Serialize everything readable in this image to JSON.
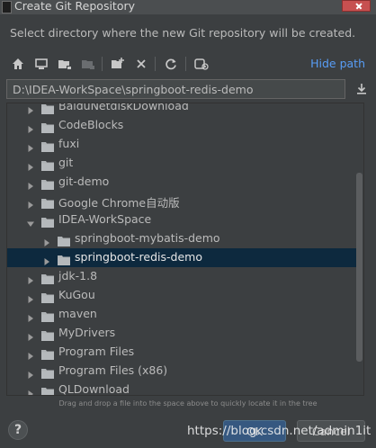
{
  "window": {
    "title": "Create Git Repository"
  },
  "dialog": {
    "description": "Select directory where the new Git repository will be created."
  },
  "toolbar": {
    "buttons": [
      {
        "icon": "home-icon",
        "tooltip": "Home Directory"
      },
      {
        "icon": "desktop-icon",
        "tooltip": "Desktop Directory"
      },
      {
        "icon": "project-folder-icon",
        "tooltip": "Project Directory"
      },
      {
        "icon": "module-folder-icon",
        "tooltip": "Module Directory"
      },
      {
        "icon": "new-folder-icon",
        "tooltip": "New Folder"
      },
      {
        "icon": "delete-icon",
        "tooltip": "Delete"
      },
      {
        "icon": "refresh-icon",
        "tooltip": "Refresh"
      },
      {
        "icon": "show-hidden-icon",
        "tooltip": "Show Hidden Files"
      }
    ],
    "hide_path_label": "Hide path"
  },
  "path": {
    "value": "D:\\IDEA-WorkSpace\\springboot-redis-demo"
  },
  "tree": {
    "items": [
      {
        "label": "BaiduNetdiskDownload",
        "expanded": false,
        "level": 0,
        "selected": false
      },
      {
        "label": "CodeBlocks",
        "expanded": false,
        "level": 0,
        "selected": false
      },
      {
        "label": "fuxi",
        "expanded": false,
        "level": 0,
        "selected": false
      },
      {
        "label": "git",
        "expanded": false,
        "level": 0,
        "selected": false
      },
      {
        "label": "git-demo",
        "expanded": false,
        "level": 0,
        "selected": false
      },
      {
        "label": "Google Chrome自动版",
        "expanded": false,
        "level": 0,
        "selected": false
      },
      {
        "label": "IDEA-WorkSpace",
        "expanded": true,
        "level": 0,
        "selected": false
      },
      {
        "label": "springboot-mybatis-demo",
        "expanded": false,
        "level": 1,
        "selected": false
      },
      {
        "label": "springboot-redis-demo",
        "expanded": false,
        "level": 1,
        "selected": true
      },
      {
        "label": "jdk-1.8",
        "expanded": false,
        "level": 0,
        "selected": false
      },
      {
        "label": "KuGou",
        "expanded": false,
        "level": 0,
        "selected": false
      },
      {
        "label": "maven",
        "expanded": false,
        "level": 0,
        "selected": false
      },
      {
        "label": "MyDrivers",
        "expanded": false,
        "level": 0,
        "selected": false
      },
      {
        "label": "Program Files",
        "expanded": false,
        "level": 0,
        "selected": false
      },
      {
        "label": "Program Files (x86)",
        "expanded": false,
        "level": 0,
        "selected": false
      },
      {
        "label": "QLDownload",
        "expanded": false,
        "level": 0,
        "selected": false
      }
    ]
  },
  "hint": "Drag and drop a file into the space above to quickly locate it in the tree",
  "buttons": {
    "help": "?",
    "ok": "OK",
    "cancel": "Cancel"
  },
  "watermark": "https://blog.csdn.net/admin1it",
  "colors": {
    "background": "#3c3f41",
    "link": "#589df6",
    "selection": "#0d293e",
    "ok_button": "#365880"
  }
}
